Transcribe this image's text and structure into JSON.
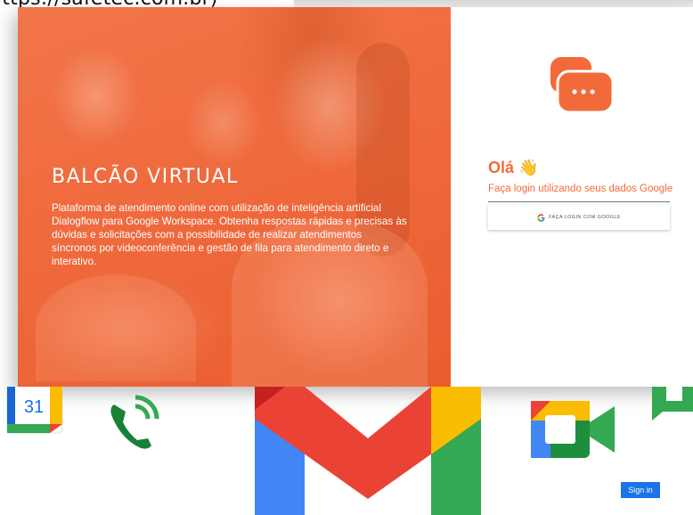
{
  "url_text": "ittps://safetec.com.br)",
  "hero": {
    "title": "BALCÃO VIRTUAL",
    "description": "Plataforma de atendimento online com utilização de inteligência artificial Dialogflow para Google Workspace. Obtenha respostas rápidas e precisas às dúvidas e solicitações com a possibilidade de realizar atendimentos síncronos por videoconferência e gestão de fila para atendimento direto e interativo."
  },
  "login": {
    "greeting": "Olá 👋",
    "subtitle": "Faça login utilizando seus dados Google",
    "google_button": "FAÇA LOGIN COM GOOGLE"
  },
  "apps": {
    "calendar_day": "31",
    "icons": [
      "calendar-icon",
      "voice-icon",
      "gmail-icon",
      "meet-icon",
      "chat-icon"
    ]
  },
  "sign_in_label": "Sign in",
  "colors": {
    "brand_orange": "#f26a3a",
    "google_blue": "#4285f4",
    "google_red": "#ea4335",
    "google_yellow": "#fbbc04",
    "google_green": "#34a853"
  }
}
